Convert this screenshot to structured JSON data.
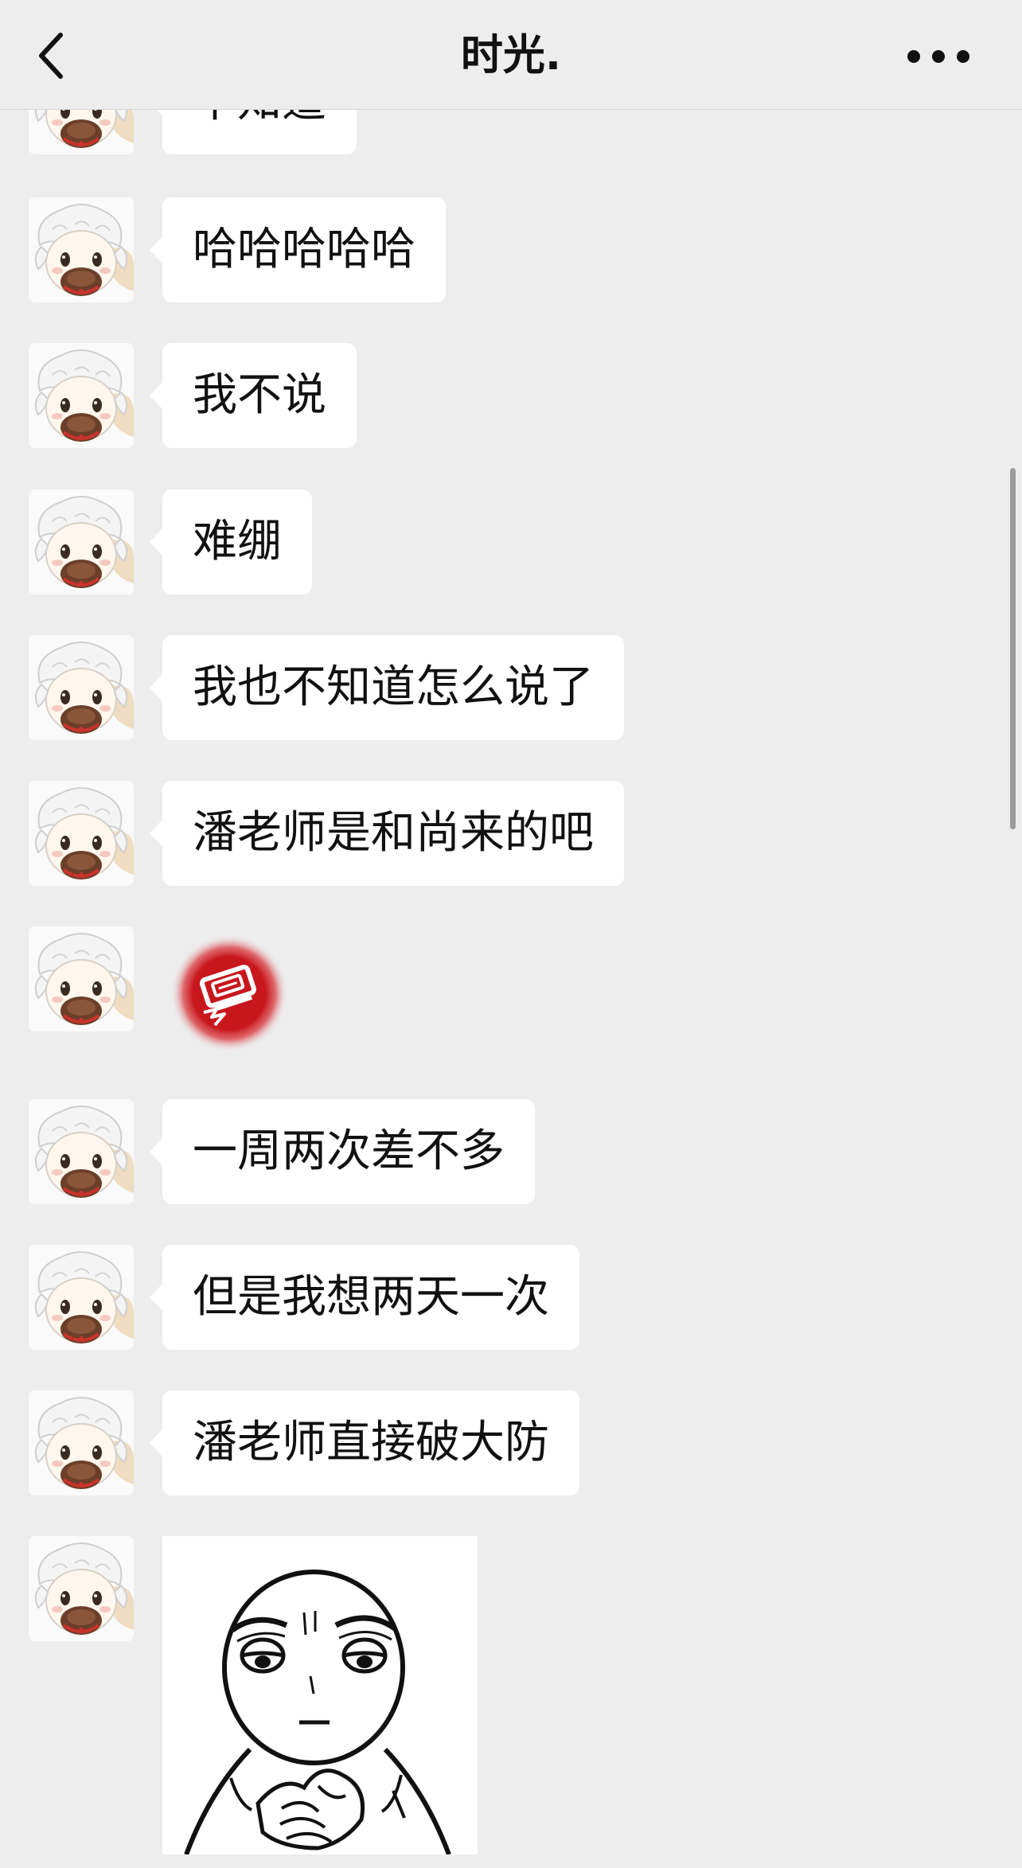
{
  "header": {
    "title": "时光.",
    "back_icon": "chevron-left-icon",
    "more_icon": "more-horizontal-icon"
  },
  "messages": [
    {
      "type": "text",
      "text": "不知道"
    },
    {
      "type": "text",
      "text": "哈哈哈哈哈"
    },
    {
      "type": "text",
      "text": "我不说"
    },
    {
      "type": "text",
      "text": "难绷"
    },
    {
      "type": "text",
      "text": "我也不知道怎么说了"
    },
    {
      "type": "text",
      "text": "潘老师是和尚来的吧"
    },
    {
      "type": "sticker",
      "sticker": "red-glowing-badge-sticker"
    },
    {
      "type": "text",
      "text": "一周两次差不多"
    },
    {
      "type": "text",
      "text": "但是我想两天一次"
    },
    {
      "type": "text",
      "text": "潘老师直接破大防"
    },
    {
      "type": "sticker",
      "sticker": "thinking-face-meme-sticker"
    }
  ],
  "colors": {
    "background": "#ededed",
    "bubble": "#ffffff",
    "text": "#111111",
    "sticker_red": "#c8161d"
  }
}
